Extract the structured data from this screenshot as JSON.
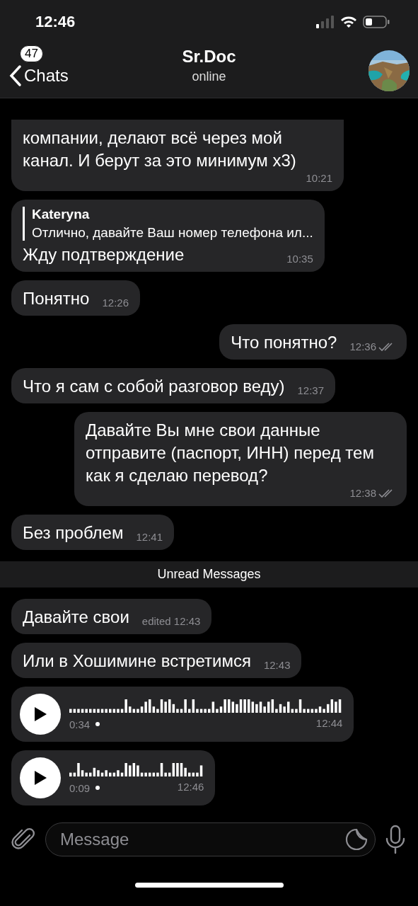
{
  "status_bar": {
    "time": "12:46"
  },
  "header": {
    "back_label": "Chats",
    "unread_badge": "47",
    "title": "Sr.Doc",
    "subtitle": "online"
  },
  "messages": [
    {
      "kind": "text",
      "outgoing": false,
      "text": "компании, делают всё через мой канал.  И берут за это минимум х3)",
      "time": "10:21"
    },
    {
      "kind": "reply",
      "outgoing": false,
      "reply_author": "Kateryna",
      "reply_text": "Отлично, давайте Ваш номер телефона ил...",
      "text": "Жду подтверждение",
      "time": "10:35"
    },
    {
      "kind": "text",
      "outgoing": false,
      "text": "Понятно",
      "time": "12:26"
    },
    {
      "kind": "text",
      "outgoing": true,
      "read": true,
      "text": "Что понятно?",
      "time": "12:36"
    },
    {
      "kind": "text",
      "outgoing": false,
      "text": "Что я сам с собой разговор веду)",
      "time": "12:37"
    },
    {
      "kind": "text",
      "outgoing": true,
      "read": true,
      "text": "Давайте Вы мне свои данные отправите (паспорт, ИНН) перед тем как я сделаю перевод?",
      "time": "12:38"
    },
    {
      "kind": "text",
      "outgoing": false,
      "text": "Без проблем",
      "time": "12:41"
    },
    {
      "kind": "divider",
      "text": "Unread Messages"
    },
    {
      "kind": "text",
      "outgoing": false,
      "text": "Давайте свои",
      "time": "edited 12:43"
    },
    {
      "kind": "text",
      "outgoing": false,
      "text": "Или в Хошимине встретимся",
      "time": "12:43"
    },
    {
      "kind": "voice",
      "outgoing": false,
      "duration": "0:34",
      "time": "12:44",
      "wide": true
    },
    {
      "kind": "voice",
      "outgoing": false,
      "duration": "0:09",
      "time": "12:46",
      "wide": false
    }
  ],
  "composer": {
    "placeholder": "Message"
  }
}
